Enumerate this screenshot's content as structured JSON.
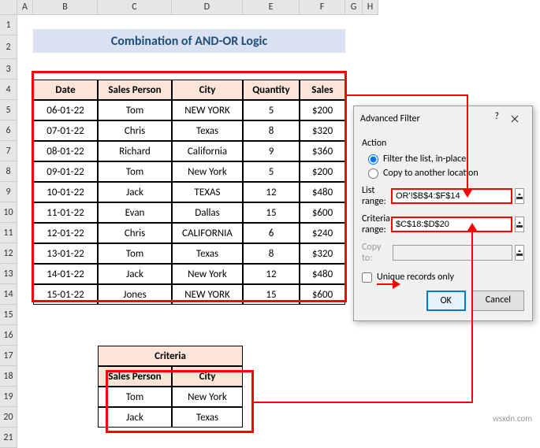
{
  "title": "Combination of AND-OR Logic",
  "columns": [
    "A",
    "B",
    "C",
    "D",
    "E",
    "F",
    "G",
    "H"
  ],
  "rowCount": 21,
  "colWidths": {
    "rowhead": 22,
    "A": 20,
    "B": 82,
    "C": 94,
    "D": 90,
    "E": 72,
    "F": 58,
    "G": 22,
    "H": 20
  },
  "rowHeights": {
    "default": 26,
    "r0": 18,
    "r2": 30
  },
  "table": {
    "headers": [
      "Date",
      "Sales Person",
      "City",
      "Quantity",
      "Sales"
    ],
    "rows": [
      [
        "06-01-22",
        "Tom",
        "NEW YORK",
        "5",
        "$200"
      ],
      [
        "07-01-22",
        "Chris",
        "Texas",
        "8",
        "$320"
      ],
      [
        "08-01-22",
        "Richard",
        "California",
        "9",
        "$360"
      ],
      [
        "09-01-22",
        "Tom",
        "New York",
        "5",
        "$200"
      ],
      [
        "10-01-22",
        "Jack",
        "TEXAS",
        "12",
        "$480"
      ],
      [
        "11-01-22",
        "Evan",
        "Dallas",
        "15",
        "$600"
      ],
      [
        "12-01-22",
        "Chris",
        "CALIFORNIA",
        "6",
        "$240"
      ],
      [
        "13-01-22",
        "Tom",
        "Texas",
        "8",
        "$320"
      ],
      [
        "14-01-22",
        "Jack",
        "New York",
        "12",
        "$480"
      ],
      [
        "15-01-22",
        "Jones",
        "NEW YORK",
        "15",
        "$600"
      ]
    ]
  },
  "criteria": {
    "title": "Criteria",
    "headers": [
      "Sales Person",
      "City"
    ],
    "rows": [
      [
        "Tom",
        "New York"
      ],
      [
        "Jack",
        "Texas"
      ]
    ]
  },
  "dialog": {
    "title": "Advanced Filter",
    "help": "?",
    "action_label": "Action",
    "radio1": "Filter the list, in-place",
    "radio2": "Copy to another location",
    "list_range_label": "List range:",
    "list_range_value": "OR'!$B$4:$F$14",
    "criteria_range_label": "Criteria range:",
    "criteria_range_value": "$C$18:$D$20",
    "copy_to_label": "Copy to:",
    "copy_to_value": "",
    "unique_label": "Unique records only",
    "ok": "OK",
    "cancel": "Cancel"
  },
  "watermark": "wsxdn.com"
}
